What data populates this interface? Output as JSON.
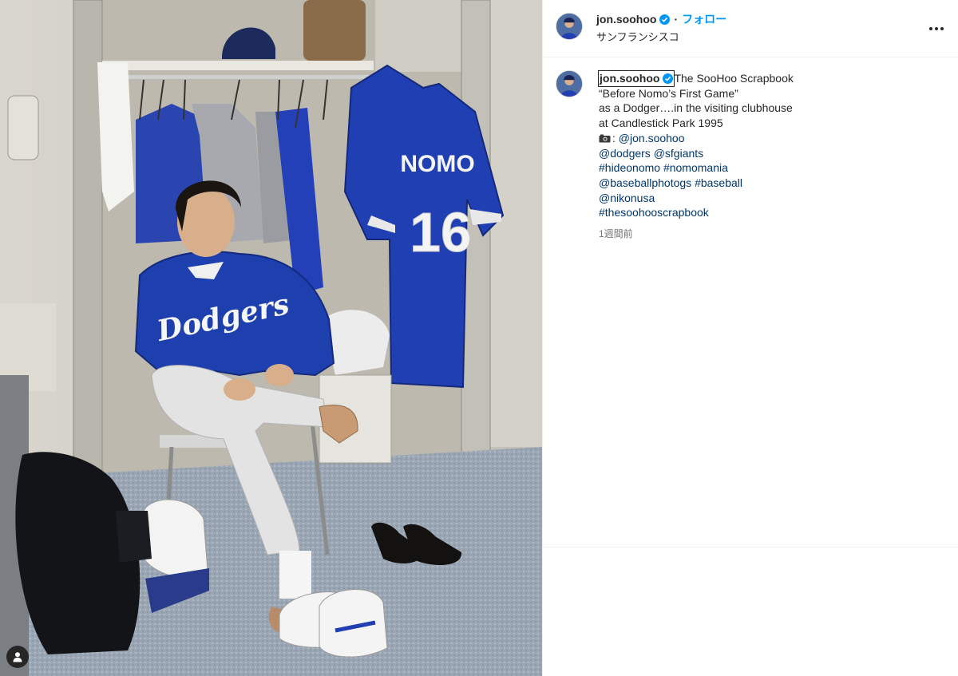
{
  "post": {
    "username": "jon.soohoo",
    "separator": "·",
    "follow_label": "フォロー",
    "location": "サンフランシスコ",
    "more_icon": "more-options-icon",
    "verified_icon": "verified-badge-icon"
  },
  "caption": {
    "username": "jon.soohoo",
    "lines": [
      "The SooHoo Scrapbook",
      "“Before Nomo’s First Game”",
      "as a Dodger….in the visiting clubhouse",
      "at Candlestick Park 1995"
    ],
    "photo_credit_prefix": ":",
    "tags": {
      "credit": "@jon.soohoo",
      "dodgers": "@dodgers",
      "sfgiants": "@sfgiants",
      "hideonomo": "#hideonomo",
      "nomomania": "#nomomania",
      "baseballphotogs": "@baseballphotogs",
      "baseball": "#baseball",
      "nikonusa": "@nikonusa",
      "thesoohooscrapbook": "#thesoohooscrapbook"
    },
    "timestamp": "1週間前"
  },
  "photo": {
    "jersey_name": "NOMO",
    "jersey_number": "16",
    "jacket_text": "Dodgers",
    "user_tags_icon": "person-icon"
  },
  "colors": {
    "link": "#00376b",
    "follow": "#0095f6",
    "verified": "#0095f6",
    "dodger_blue": "#1f3fb3"
  }
}
